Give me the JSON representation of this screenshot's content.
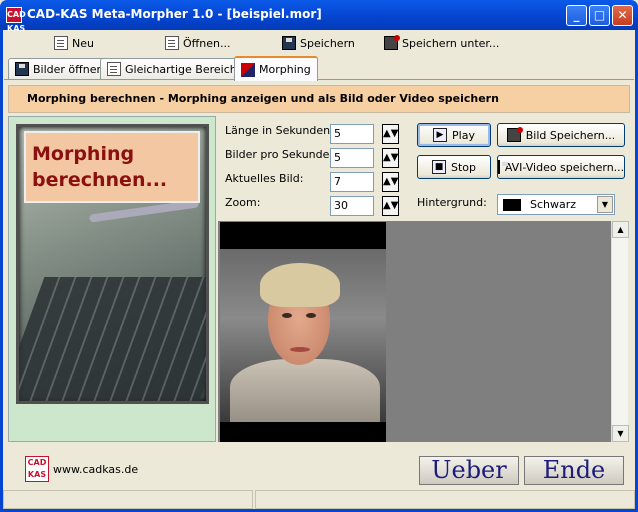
{
  "window": {
    "app_icon_text": "CAD KAS",
    "title": "CAD-KAS Meta-Morpher 1.0 - [beispiel.mor]",
    "min_glyph": "_",
    "max_glyph": "□",
    "close_glyph": "✕"
  },
  "toolbar": {
    "new_label": "Neu",
    "open_label": "Öffnen...",
    "save_label": "Speichern",
    "save_as_label": "Speichern unter..."
  },
  "tabs": [
    {
      "label": "Bilder öffnen",
      "icon": "images-icon"
    },
    {
      "label": "Gleichartige Bereiche",
      "icon": "areas-icon"
    },
    {
      "label": "Morphing",
      "icon": "morph-icon",
      "active": true
    }
  ],
  "banner": "Morphing berechnen - Morphing anzeigen und als Bild oder Video speichern",
  "left_card": {
    "line1": "Morphing",
    "line2": "berechnen..."
  },
  "fields": {
    "length": {
      "label": "Länge in Sekunden:",
      "value": "5"
    },
    "fps": {
      "label": "Bilder pro Sekunde:",
      "value": "5"
    },
    "frame": {
      "label": "Aktuelles Bild:",
      "value": "7"
    },
    "zoom": {
      "label": "Zoom:",
      "value": "30"
    }
  },
  "buttons": {
    "play": "Play",
    "stop": "Stop",
    "save_image": "Bild Speichern...",
    "save_avi": "AVI-Video speichern..."
  },
  "background": {
    "label": "Hintergrund:",
    "value": "Schwarz",
    "swatch_color": "#000000"
  },
  "footer": {
    "logo_text": "CAD KAS",
    "url": "www.cadkas.de",
    "about": "Ueber",
    "exit": "Ende"
  },
  "colors": {
    "banner": "#f6cfa3",
    "left_panel": "#cde7cd",
    "card_text": "#8b1010",
    "big_button_text": "#1c1c7c"
  }
}
